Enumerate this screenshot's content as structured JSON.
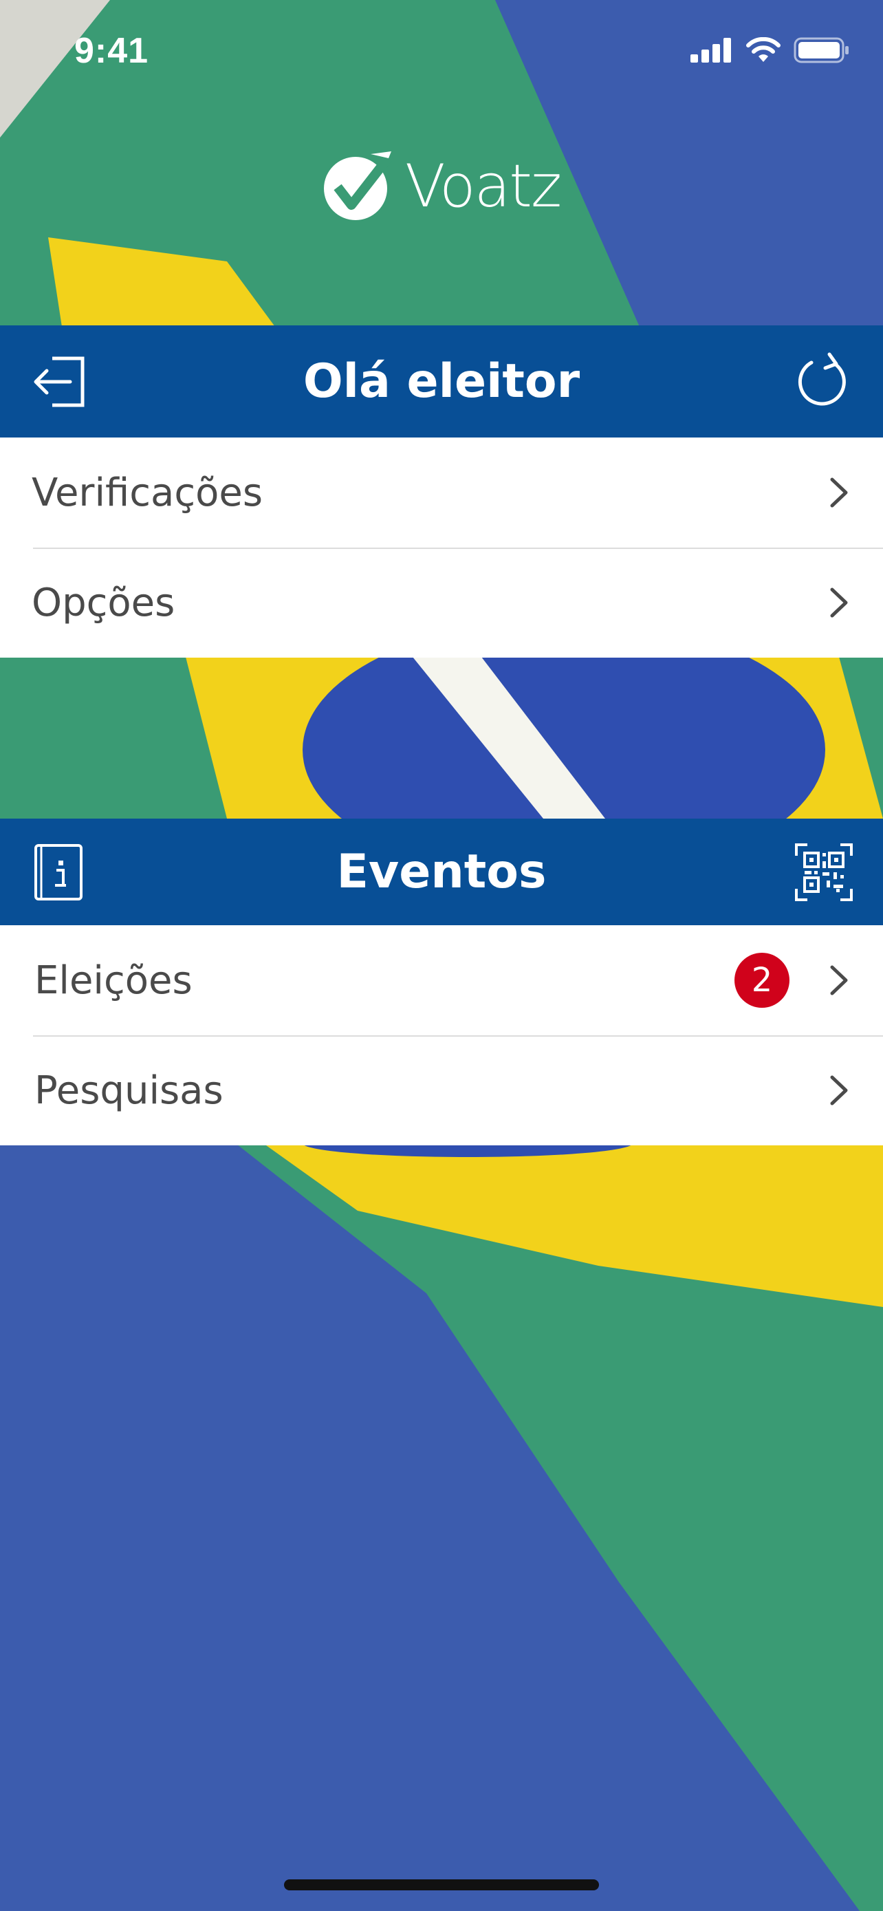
{
  "status_bar": {
    "time": "9:41"
  },
  "logo": {
    "text": "Voatz"
  },
  "greeting_bar": {
    "title": "Olá eleitor",
    "left_icon": "logout-icon",
    "right_icon": "refresh-icon"
  },
  "account_menu": [
    {
      "label": "Verificações"
    },
    {
      "label": "Opções"
    }
  ],
  "events_bar": {
    "title": "Eventos",
    "left_icon": "info-book-icon",
    "right_icon": "qr-code-icon"
  },
  "events_menu": [
    {
      "label": "Eleições",
      "badge": "2"
    },
    {
      "label": "Pesquisas"
    }
  ],
  "colors": {
    "bar": "#084f96",
    "badge": "#d0021b",
    "flag_green": "#3a9b74",
    "flag_yellow": "#f2d21b",
    "flag_blue": "#3c5cae"
  }
}
